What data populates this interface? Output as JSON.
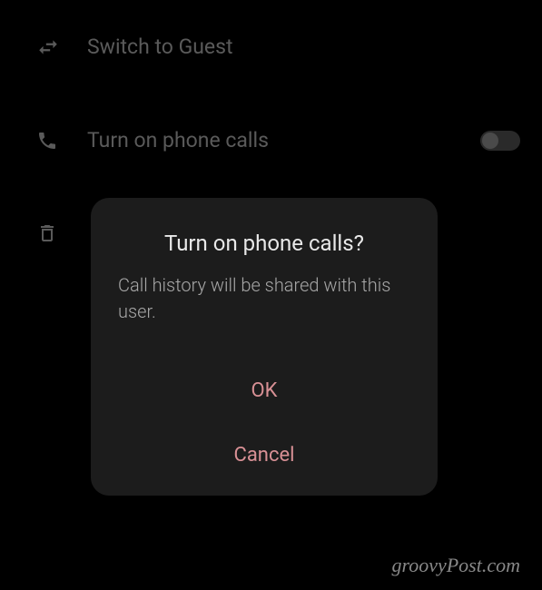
{
  "settings": {
    "items": [
      {
        "label": "Switch to Guest"
      },
      {
        "label": "Turn on phone calls"
      },
      {
        "label": ""
      }
    ]
  },
  "dialog": {
    "title": "Turn on phone calls?",
    "message": "Call history will be shared with this user.",
    "ok_label": "OK",
    "cancel_label": "Cancel"
  },
  "watermark": "groovyPost.com"
}
